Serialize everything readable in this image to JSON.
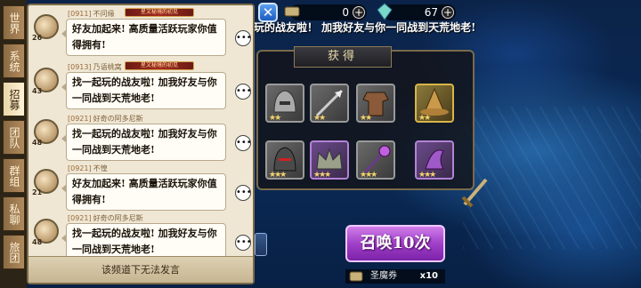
{
  "top": {
    "res1_value": "0",
    "res2_value": "67",
    "scroll_message": "玩的战友啦！ 加我好友与你一同战到天荒地老!"
  },
  "reward": {
    "title": "获得"
  },
  "summon": {
    "button_label": "召唤10次",
    "ticket_label": "圣魔券",
    "ticket_count": "x10"
  },
  "tabs": [
    {
      "label": "世界",
      "active": false
    },
    {
      "label": "系统",
      "active": false
    },
    {
      "label": "招募",
      "active": true
    },
    {
      "label": "团队",
      "active": false
    },
    {
      "label": "群组",
      "active": false
    },
    {
      "label": "私聊",
      "active": false
    },
    {
      "label": "旅团",
      "active": false
    }
  ],
  "messages": [
    {
      "server": "[0911]",
      "name": "不问缘",
      "level": "26",
      "badge": "星文秘境的初见",
      "text": "好友加起来! 高质量活跃玩家你值得拥有!"
    },
    {
      "server": "[0913]",
      "name": "乃语桃窝",
      "level": "43",
      "badge": "星文秘境的初见",
      "text": "找一起玩的战友啦! 加我好友与你一同战到天荒地老!"
    },
    {
      "server": "[0921]",
      "name": "好奇の阿多尼斯",
      "level": "48",
      "badge": "",
      "text": "找一起玩的战友啦! 加我好友与你一同战到天荒地老!"
    },
    {
      "server": "[0921]",
      "name": "不惶",
      "level": "21",
      "badge": "",
      "text": "好友加起来! 高质量活跃玩家你值得拥有!"
    },
    {
      "server": "[0921]",
      "name": "好奇の阿多尼斯",
      "level": "48",
      "badge": "",
      "text": "找一起玩的战友啦! 加我好友与你一同战到天荒地老!"
    }
  ],
  "chat_footer": "该频道下无法发言",
  "colors": {
    "summon_purple": "#a040c8",
    "accent_gold": "#d8b54a",
    "parchment": "#efe7d4"
  }
}
